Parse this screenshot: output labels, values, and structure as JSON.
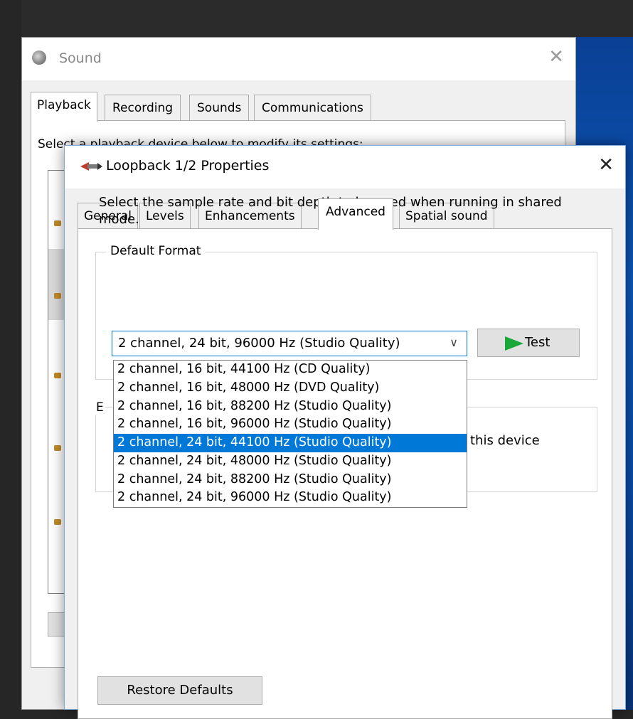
{
  "sound_window": {
    "title": "Sound",
    "close_glyph": "✕",
    "tabs": [
      {
        "label": "Playback",
        "active": true
      },
      {
        "label": "Recording",
        "active": false
      },
      {
        "label": "Sounds",
        "active": false
      },
      {
        "label": "Communications",
        "active": false
      }
    ],
    "hint": "Select a playback device below to modify its settings:"
  },
  "dialog": {
    "title": "Loopback 1/2 Properties",
    "close_glyph": "✕",
    "tabs": [
      {
        "label": "General",
        "active": false
      },
      {
        "label": "Levels",
        "active": false
      },
      {
        "label": "Enhancements",
        "active": false
      },
      {
        "label": "Advanced",
        "active": true
      },
      {
        "label": "Spatial sound",
        "active": false
      }
    ],
    "default_format": {
      "legend": "Default Format",
      "description": "Select the sample rate and bit depth to be used when running in shared mode.",
      "selected": "2 channel, 24 bit, 96000 Hz (Studio Quality)",
      "arrow_glyph": "∨",
      "test_label": "Test",
      "options": [
        "2 channel, 16 bit, 44100 Hz (CD Quality)",
        "2 channel, 16 bit, 48000 Hz (DVD Quality)",
        "2 channel, 16 bit, 88200 Hz (Studio Quality)",
        "2 channel, 16 bit, 96000 Hz (Studio Quality)",
        "2 channel, 24 bit, 44100 Hz (Studio Quality)",
        "2 channel, 24 bit, 48000 Hz (Studio Quality)",
        "2 channel, 24 bit, 88200 Hz (Studio Quality)",
        "2 channel, 24 bit, 96000 Hz (Studio Quality)"
      ],
      "highlighted_index": 4
    },
    "exclusive": {
      "legend_stub": "E",
      "visible_tail": "this device"
    },
    "restore_label": "Restore Defaults"
  },
  "colors": {
    "highlight": "#0078d7",
    "play_green": "#1ba83a"
  }
}
